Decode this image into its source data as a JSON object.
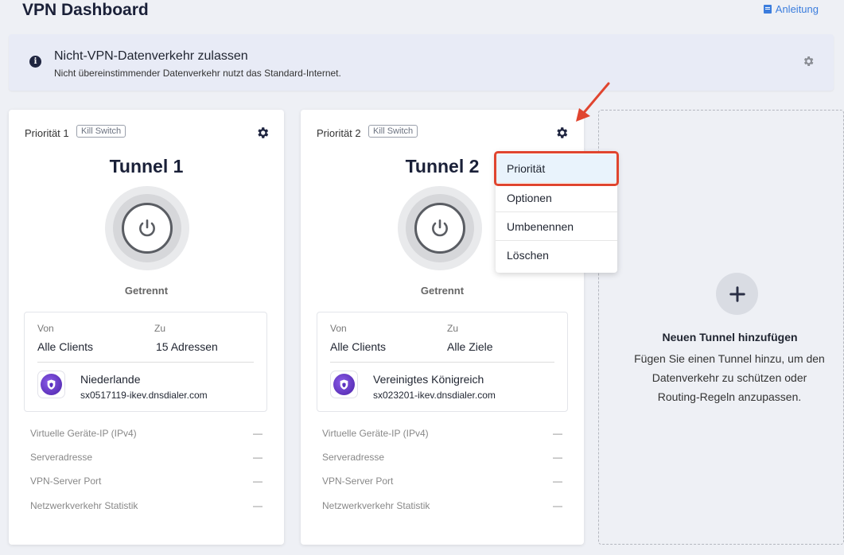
{
  "header": {
    "title": "VPN Dashboard",
    "manual_link": "Anleitung",
    "manual_icon": "book-icon"
  },
  "banner": {
    "title": "Nicht-VPN-Datenverkehr zulassen",
    "subtitle": "Nicht übereinstimmender Datenverkehr nutzt das Standard-Internet."
  },
  "tunnels": [
    {
      "priority": "Priorität 1",
      "kill_switch": "Kill Switch",
      "name": "Tunnel 1",
      "status": "Getrennt",
      "from_label": "Von",
      "from_value": "Alle Clients",
      "to_label": "Zu",
      "to_value": "15 Adressen",
      "country": "Niederlande",
      "host": "sx0517119-ikev.dnsdialer.com",
      "stats": [
        {
          "label": "Virtuelle Geräte-IP (IPv4)",
          "value": "—"
        },
        {
          "label": "Serveradresse",
          "value": "—"
        },
        {
          "label": "VPN-Server Port",
          "value": "—"
        },
        {
          "label": "Netzwerkverkehr Statistik",
          "value": "—"
        }
      ]
    },
    {
      "priority": "Priorität 2",
      "kill_switch": "Kill Switch",
      "name": "Tunnel 2",
      "status": "Getrennt",
      "from_label": "Von",
      "from_value": "Alle Clients",
      "to_label": "Zu",
      "to_value": "Alle Ziele",
      "country": "Vereinigtes Königreich",
      "host": "sx023201-ikev.dnsdialer.com",
      "stats": [
        {
          "label": "Virtuelle Geräte-IP (IPv4)",
          "value": "—"
        },
        {
          "label": "Serveradresse",
          "value": "—"
        },
        {
          "label": "VPN-Server Port",
          "value": "—"
        },
        {
          "label": "Netzwerkverkehr Statistik",
          "value": "—"
        }
      ]
    }
  ],
  "context_menu": {
    "items": [
      "Priorität",
      "Optionen",
      "Umbenennen",
      "Löschen"
    ],
    "selected": "Priorität"
  },
  "add_tunnel": {
    "title": "Neuen Tunnel hinzufügen",
    "description": "Fügen Sie einen Tunnel hinzu, um den Datenverkehr zu schützen oder Routing-Regeln anzupassen."
  },
  "colors": {
    "accent": "#3b7ddd",
    "highlight": "#e0452f",
    "vpn_logo": "#6a3fd0"
  }
}
